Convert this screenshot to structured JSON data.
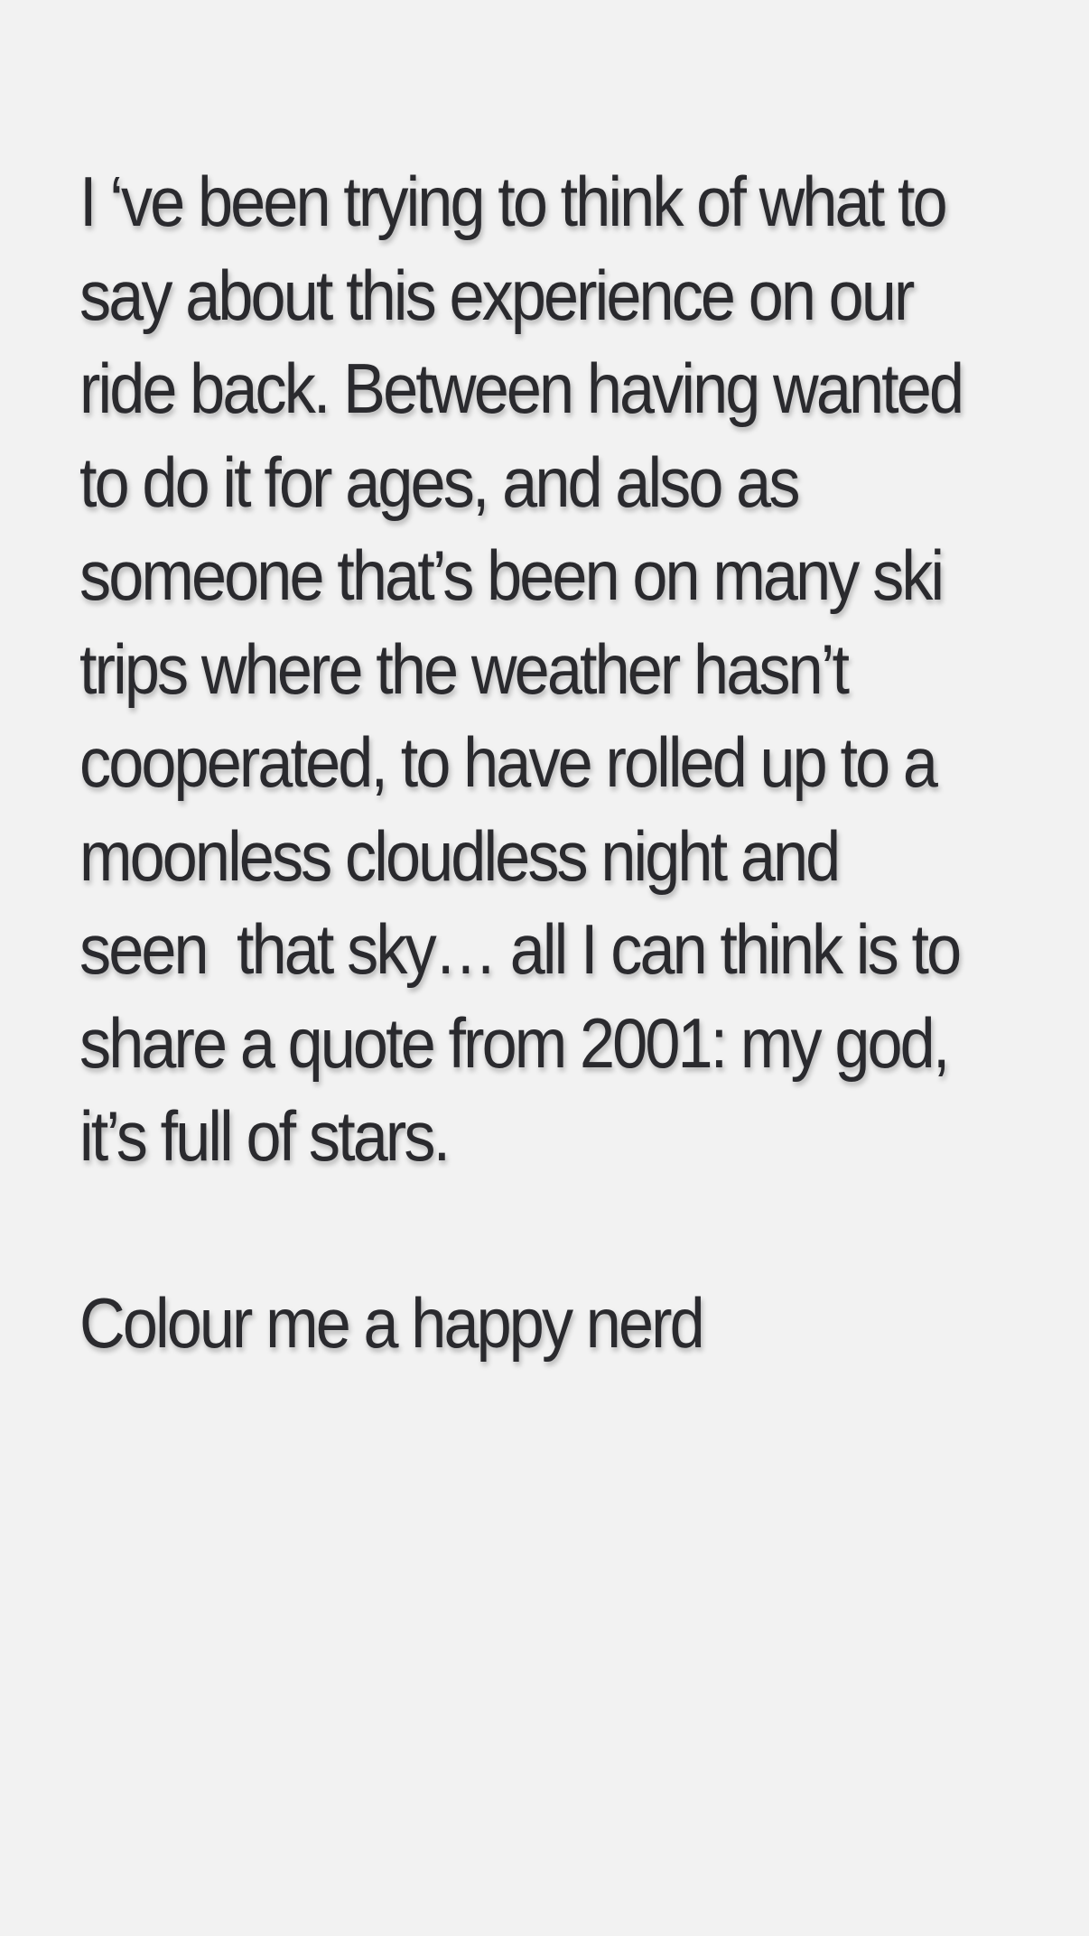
{
  "story": {
    "paragraph_lines": [
      "I ‘ve been trying to think of what to",
      "say about this experience on our",
      "ride back. Between having wanted",
      "to do it for ages, and also as",
      "someone that’s been on many ski",
      "trips where the weather hasn’t",
      "cooperated, to have rolled up to a",
      "moonless cloudless night and",
      "seen  that sky… all I can think is to",
      "share a quote from 2001: my god,",
      "it’s full of stars."
    ],
    "closing_line": "Colour me a happy nerd"
  },
  "colors": {
    "background": "#f2f2f2",
    "text": "#2a2a2e"
  }
}
